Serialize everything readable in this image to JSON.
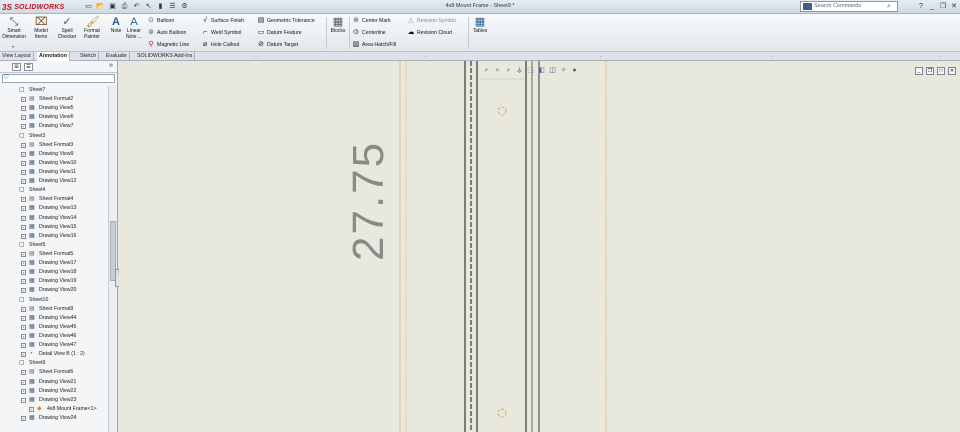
{
  "app": {
    "logo_text": "SOLIDWORKS",
    "window_title": "4x8 Mount Frame - Sheet9 *",
    "search_placeholder": "Search Commands"
  },
  "ribbon": {
    "big_buttons": [
      {
        "label": "Smart Dimension",
        "icon": "smart-dimension-icon"
      },
      {
        "label": "Model Items",
        "icon": "model-items-icon"
      },
      {
        "label": "Spell Checker",
        "icon": "spell-checker-icon"
      },
      {
        "label": "Format Painter",
        "icon": "format-painter-icon"
      },
      {
        "label": "Note",
        "icon": "note-icon"
      },
      {
        "label": "Linear Note ...",
        "icon": "linear-note-icon"
      }
    ],
    "small_col1": [
      "Balloon",
      "Auto Balloon",
      "Magnetic Line"
    ],
    "small_col2": [
      "Surface Finish",
      "Weld Symbol",
      "Hole Callout"
    ],
    "small_col3": [
      "Geometric Tolerance",
      "Datum Feature",
      "Datum Target"
    ],
    "blocks_label": "Blocks",
    "small_col4": [
      "Center Mark",
      "Centerline",
      "Area Hatch/Fill"
    ],
    "small_col5": [
      "Revision Symbol",
      "Revision Cloud"
    ],
    "tables_label": "Tables"
  },
  "tabs": [
    "View Layout",
    "Annotation",
    "Sketch",
    "Evaluate",
    "SOLIDWORKS Add-Ins"
  ],
  "active_tab": "Annotation",
  "tree": [
    {
      "label": "Sheet7",
      "level": 0,
      "icon": "sheet-icon"
    },
    {
      "label": "Sheet Format2",
      "level": 1,
      "icon": "sheet-format-icon"
    },
    {
      "label": "Drawing View5",
      "level": 1,
      "icon": "drawing-view-icon"
    },
    {
      "label": "Drawing View6",
      "level": 1,
      "icon": "drawing-view-icon"
    },
    {
      "label": "Drawing View7",
      "level": 1,
      "icon": "drawing-view-icon"
    },
    {
      "label": "Sheet3",
      "level": 0,
      "icon": "sheet-icon"
    },
    {
      "label": "Sheet Format3",
      "level": 1,
      "icon": "sheet-format-icon"
    },
    {
      "label": "Drawing View9",
      "level": 1,
      "icon": "drawing-view-icon"
    },
    {
      "label": "Drawing View10",
      "level": 1,
      "icon": "drawing-view-icon"
    },
    {
      "label": "Drawing View11",
      "level": 1,
      "icon": "drawing-view-icon"
    },
    {
      "label": "Drawing View12",
      "level": 1,
      "icon": "drawing-view-icon"
    },
    {
      "label": "Sheet4",
      "level": 0,
      "icon": "sheet-icon"
    },
    {
      "label": "Sheet Format4",
      "level": 1,
      "icon": "sheet-format-icon"
    },
    {
      "label": "Drawing View13",
      "level": 1,
      "icon": "drawing-view-icon"
    },
    {
      "label": "Drawing View14",
      "level": 1,
      "icon": "drawing-view-icon"
    },
    {
      "label": "Drawing View15",
      "level": 1,
      "icon": "drawing-view-icon"
    },
    {
      "label": "Drawing View16",
      "level": 1,
      "icon": "drawing-view-icon"
    },
    {
      "label": "Sheet5",
      "level": 0,
      "icon": "sheet-icon"
    },
    {
      "label": "Sheet Format5",
      "level": 1,
      "icon": "sheet-format-icon"
    },
    {
      "label": "Drawing View17",
      "level": 1,
      "icon": "drawing-view-icon"
    },
    {
      "label": "Drawing View18",
      "level": 1,
      "icon": "drawing-view-icon"
    },
    {
      "label": "Drawing View19",
      "level": 1,
      "icon": "drawing-view-icon"
    },
    {
      "label": "Drawing View20",
      "level": 1,
      "icon": "drawing-view-icon"
    },
    {
      "label": "Sheet10",
      "level": 0,
      "icon": "sheet-icon"
    },
    {
      "label": "Sheet Format9",
      "level": 1,
      "icon": "sheet-format-icon"
    },
    {
      "label": "Drawing View44",
      "level": 1,
      "icon": "drawing-view-icon"
    },
    {
      "label": "Drawing View45",
      "level": 1,
      "icon": "drawing-view-icon"
    },
    {
      "label": "Drawing View46",
      "level": 1,
      "icon": "drawing-view-icon"
    },
    {
      "label": "Drawing View47",
      "level": 1,
      "icon": "drawing-view-icon"
    },
    {
      "label": "Detail View B (1 : 2)",
      "level": 1,
      "icon": "detail-view-icon"
    },
    {
      "label": "Sheet9",
      "level": 0,
      "icon": "sheet-icon"
    },
    {
      "label": "Sheet Format6",
      "level": 1,
      "icon": "sheet-format-icon"
    },
    {
      "label": "Drawing View21",
      "level": 1,
      "icon": "drawing-view-icon"
    },
    {
      "label": "Drawing View22",
      "level": 1,
      "icon": "drawing-view-icon"
    },
    {
      "label": "Drawing View23",
      "level": 1,
      "icon": "drawing-view-icon",
      "expanded": true
    },
    {
      "label": "4x8 Mount Frame<1>",
      "level": 2,
      "icon": "part-icon"
    },
    {
      "label": "Drawing View24",
      "level": 1,
      "icon": "drawing-view-icon"
    }
  ],
  "canvas": {
    "dimension_text": "27.75"
  },
  "colors": {
    "canvas_bg": "#e9e8dc",
    "sheet_border": "#d99a55",
    "dimension": "#8a8a8a",
    "geometry": "#111111"
  }
}
